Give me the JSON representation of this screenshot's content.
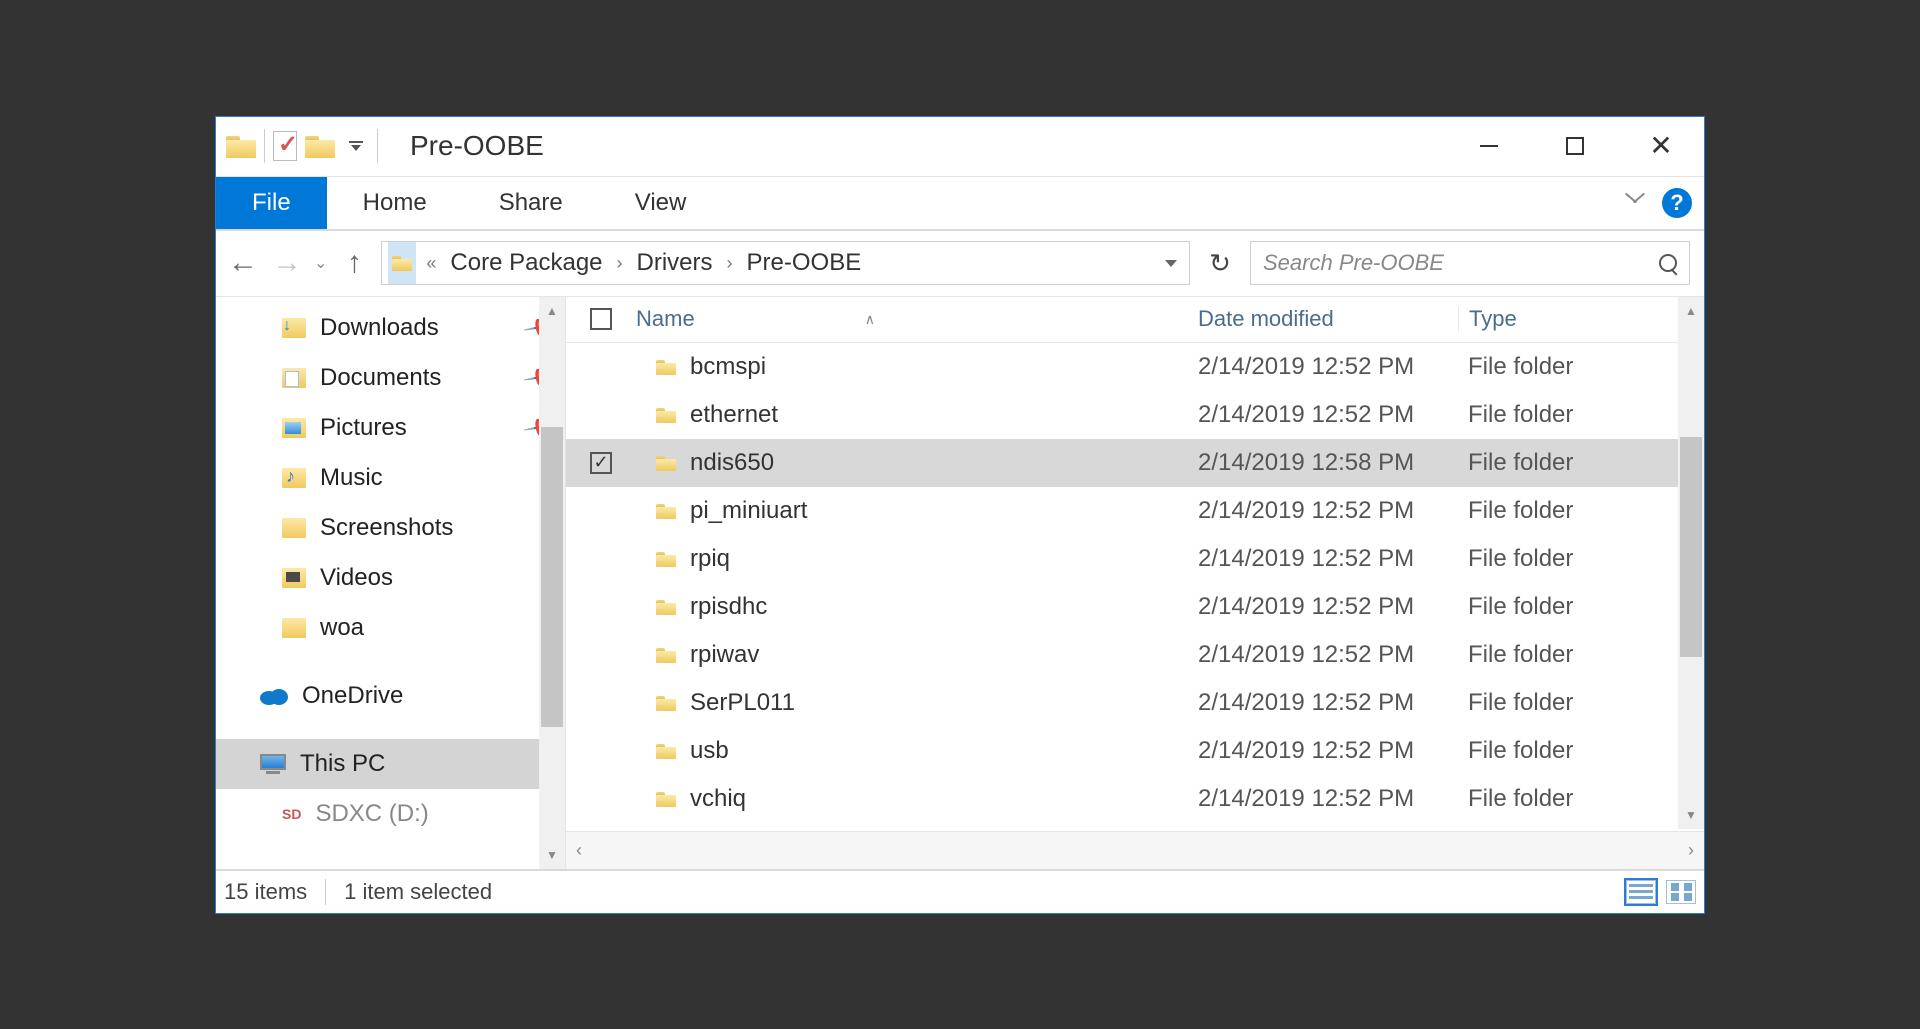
{
  "window": {
    "title": "Pre-OOBE"
  },
  "ribbon": {
    "file": "File",
    "home": "Home",
    "share": "Share",
    "view": "View"
  },
  "breadcrumb": {
    "segments": [
      "Core Package",
      "Drivers",
      "Pre-OOBE"
    ]
  },
  "search": {
    "placeholder": "Search Pre-OOBE"
  },
  "nav": {
    "items": [
      {
        "label": "Downloads",
        "icon": "downloads",
        "pinned": true
      },
      {
        "label": "Documents",
        "icon": "documents",
        "pinned": true
      },
      {
        "label": "Pictures",
        "icon": "pictures",
        "pinned": true
      },
      {
        "label": "Music",
        "icon": "music",
        "pinned": false
      },
      {
        "label": "Screenshots",
        "icon": "plain",
        "pinned": false
      },
      {
        "label": "Videos",
        "icon": "videos",
        "pinned": false
      },
      {
        "label": "woa",
        "icon": "plain",
        "pinned": false
      }
    ],
    "onedrive": "OneDrive",
    "thispc": "This PC",
    "sdcard": "SDXC (D:)"
  },
  "columns": {
    "name": "Name",
    "date": "Date modified",
    "type": "Type"
  },
  "files": [
    {
      "name": "bcmspi",
      "date": "2/14/2019 12:52 PM",
      "type": "File folder",
      "selected": false
    },
    {
      "name": "ethernet",
      "date": "2/14/2019 12:52 PM",
      "type": "File folder",
      "selected": false
    },
    {
      "name": "ndis650",
      "date": "2/14/2019 12:58 PM",
      "type": "File folder",
      "selected": true
    },
    {
      "name": "pi_miniuart",
      "date": "2/14/2019 12:52 PM",
      "type": "File folder",
      "selected": false
    },
    {
      "name": "rpiq",
      "date": "2/14/2019 12:52 PM",
      "type": "File folder",
      "selected": false
    },
    {
      "name": "rpisdhc",
      "date": "2/14/2019 12:52 PM",
      "type": "File folder",
      "selected": false
    },
    {
      "name": "rpiwav",
      "date": "2/14/2019 12:52 PM",
      "type": "File folder",
      "selected": false
    },
    {
      "name": "SerPL011",
      "date": "2/14/2019 12:52 PM",
      "type": "File folder",
      "selected": false
    },
    {
      "name": "usb",
      "date": "2/14/2019 12:52 PM",
      "type": "File folder",
      "selected": false
    },
    {
      "name": "vchiq",
      "date": "2/14/2019 12:52 PM",
      "type": "File folder",
      "selected": false
    }
  ],
  "status": {
    "count": "15 items",
    "selection": "1 item selected"
  }
}
